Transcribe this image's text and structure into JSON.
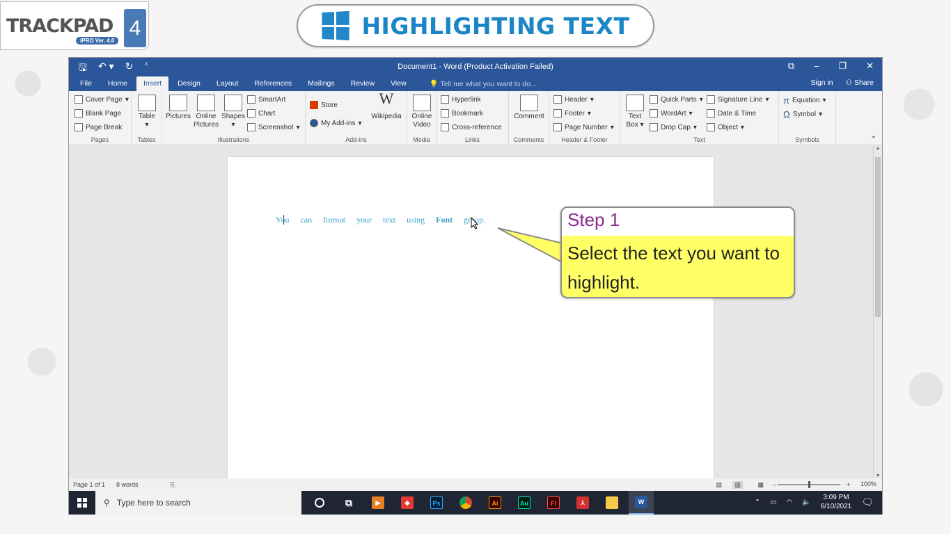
{
  "logo": {
    "text": "TRACKPAD",
    "version": "iPRO Ver. 4.0",
    "number": "4"
  },
  "title": "HIGHLIGHTING TEXT",
  "word": {
    "window_title": "Document1 - Word (Product Activation Failed)",
    "tabs": [
      "File",
      "Home",
      "Insert",
      "Design",
      "Layout",
      "References",
      "Mailings",
      "Review",
      "View"
    ],
    "active_tab": "Insert",
    "tell_me": "Tell me what you want to do...",
    "sign_in": "Sign in",
    "share": "Share",
    "ribbon": {
      "pages": {
        "label": "Pages",
        "items": [
          "Cover Page",
          "Blank Page",
          "Page Break"
        ]
      },
      "tables": {
        "label": "Tables",
        "item": "Table"
      },
      "illustrations": {
        "label": "Illustrations",
        "pictures": "Pictures",
        "online_pictures_1": "Online",
        "online_pictures_2": "Pictures",
        "shapes": "Shapes",
        "smartart": "SmartArt",
        "chart": "Chart",
        "screenshot": "Screenshot"
      },
      "addins": {
        "label": "Add-ins",
        "store": "Store",
        "my_addins": "My Add-ins",
        "wikipedia": "Wikipedia"
      },
      "media": {
        "label": "Media",
        "online_video_1": "Online",
        "online_video_2": "Video"
      },
      "links": {
        "label": "Links",
        "items": [
          "Hyperlink",
          "Bookmark",
          "Cross-reference"
        ]
      },
      "comments": {
        "label": "Comments",
        "item": "Comment"
      },
      "header_footer": {
        "label": "Header & Footer",
        "items": [
          "Header",
          "Footer",
          "Page Number"
        ]
      },
      "text": {
        "label": "Text",
        "text_box_1": "Text",
        "text_box_2": "Box",
        "col1": [
          "Quick Parts",
          "WordArt",
          "Drop Cap"
        ],
        "col2": [
          "Signature Line",
          "Date & Time",
          "Object"
        ]
      },
      "symbols": {
        "label": "Symbols",
        "items": [
          "Equation",
          "Symbol"
        ]
      }
    },
    "document": {
      "text_before": "You can format your text using",
      "bold": "Font",
      "text_after": "group."
    },
    "status": {
      "page": "Page 1 of 1",
      "words": "8 words",
      "zoom": "100%"
    },
    "taskbar": {
      "search_placeholder": "Type here to search",
      "time": "3:09 PM",
      "date": "6/10/2021"
    }
  },
  "callout": {
    "heading": "Step 1",
    "body": "Select the text you want to highlight."
  }
}
